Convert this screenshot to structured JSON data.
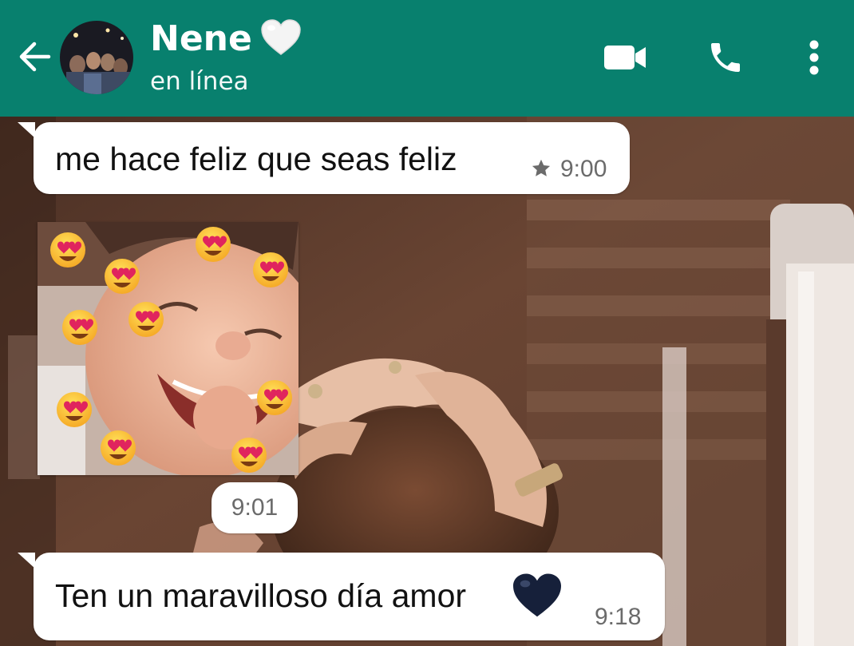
{
  "header": {
    "contact_name": "Nene",
    "status": "en línea",
    "colors": {
      "bar": "#08806e",
      "icon": "#ffffff"
    },
    "icons": {
      "back": "arrow-back-icon",
      "name_emoji": "white-heart-icon",
      "video": "video-call-icon",
      "voice": "phone-call-icon",
      "menu": "more-vert-icon"
    }
  },
  "messages": [
    {
      "type": "text",
      "text": "me hace feliz que seas feliz",
      "time": "9:00",
      "starred": true,
      "star_icon": "star-icon"
    },
    {
      "type": "image",
      "image_description_icon": "baby-photo-with-heart-eyes-emojis",
      "time": "9:01"
    },
    {
      "type": "text",
      "text": "Ten un maravilloso día amor",
      "emoji_icon": "black-heart-icon",
      "time": "9:18"
    }
  ]
}
